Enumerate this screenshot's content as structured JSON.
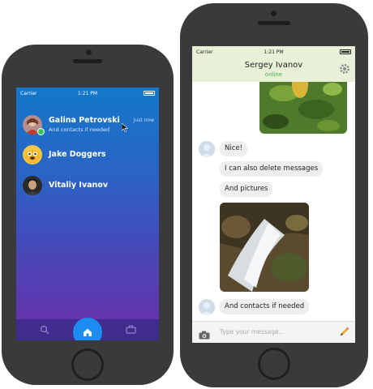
{
  "left_phone": {
    "status": {
      "carrier": "Carrier",
      "time": "1:21 PM"
    },
    "contacts": [
      {
        "name": "Galina Petrovski",
        "subtitle": "And contacts if needed",
        "time": "Just now"
      },
      {
        "name": "Jake Doggers",
        "subtitle": "",
        "time": ""
      },
      {
        "name": "Vitaliy Ivanov",
        "subtitle": "",
        "time": ""
      }
    ],
    "tabs": {
      "search": "search-icon",
      "home": "home-icon",
      "briefcase": "briefcase-icon"
    }
  },
  "right_phone": {
    "status": {
      "carrier": "Carrier",
      "time": "1:21 PM"
    },
    "header": {
      "name": "Sergey Ivanov",
      "status": "online"
    },
    "messages": [
      {
        "text": "Nice!"
      },
      {
        "text": "I can also delete messages"
      },
      {
        "text": "And pictures"
      },
      {
        "text": "And contacts if needed"
      }
    ],
    "input": {
      "placeholder": "Type your message..."
    }
  },
  "colors": {
    "accent": "#1d8cf0",
    "online": "#3fae3f",
    "tabbar": "#402c8e"
  }
}
